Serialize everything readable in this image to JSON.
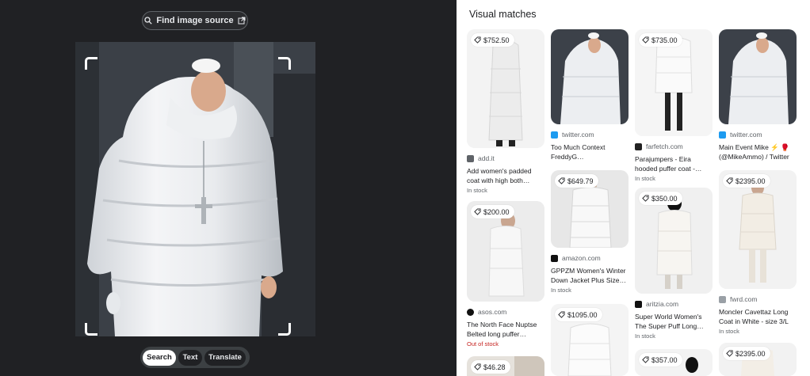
{
  "left": {
    "find_source_label": "Find image source",
    "modes": [
      "Search",
      "Text",
      "Translate"
    ],
    "active_mode": "Search"
  },
  "right": {
    "title": "Visual matches",
    "results": [
      {
        "price": "$752.50",
        "source": "add.it",
        "title": "Add women's padded coat with high both…",
        "stock": "In stock",
        "favicon_color": "#5f6368"
      },
      {
        "price": "",
        "source": "twitter.com",
        "title": "Too Much Context FreddyG…",
        "stock": "",
        "favicon_color": "#1d9bf0"
      },
      {
        "price": "$735.00",
        "source": "farfetch.com",
        "title": "Parajumpers - Eira hooded puffer coat -…",
        "stock": "In stock",
        "favicon_color": "#222222"
      },
      {
        "price": "",
        "source": "twitter.com",
        "title": "Main Event Mike ⚡ 🥊 (@MikeAmmo) / Twitter",
        "stock": "",
        "favicon_color": "#1d9bf0"
      },
      {
        "price": "$200.00",
        "source": "asos.com",
        "title": "The North Face Nuptse Belted long puffer…",
        "stock": "Out of stock",
        "favicon_color": "#111111"
      },
      {
        "price": "$649.79",
        "source": "amazon.com",
        "title": "GPPZM Women's Winter Down Jacket Plus Size…",
        "stock": "In stock",
        "favicon_color": "#111111"
      },
      {
        "price": "$350.00",
        "source": "aritzia.com",
        "title": "Super World Women's The Super Puff Long…",
        "stock": "In stock",
        "favicon_color": "#111111"
      },
      {
        "price": "$2395.00",
        "source": "fwrd.com",
        "title": "Moncler Cavettaz Long Coat in White - size 3/L",
        "stock": "In stock",
        "favicon_color": "#9aa0a6"
      },
      {
        "price": "$46.28",
        "source": "",
        "title": "",
        "stock": "",
        "favicon_color": ""
      },
      {
        "price": "$1095.00",
        "source": "",
        "title": "",
        "stock": "",
        "favicon_color": ""
      },
      {
        "price": "$357.00",
        "source": "",
        "title": "",
        "stock": "",
        "favicon_color": ""
      },
      {
        "price": "$2395.00",
        "source": "",
        "title": "",
        "stock": "",
        "favicon_color": ""
      }
    ]
  }
}
